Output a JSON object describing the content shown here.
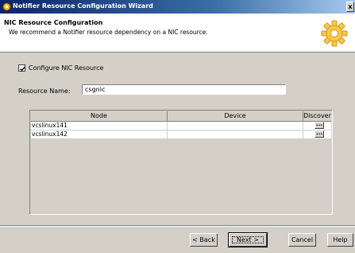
{
  "window": {
    "title": "Notifier Resource Configuration Wizard",
    "close_glyph": "x"
  },
  "header": {
    "title": "NIC Resource Configuration",
    "subtitle": "We recommend a Notifier resource dependency on a NIC resource."
  },
  "configure_nic": {
    "label": "Configure NIC Resource",
    "checked": true
  },
  "resource_name": {
    "label": "Resource Name:",
    "value": "csgnic"
  },
  "table": {
    "columns": [
      "Node",
      "Device",
      "Discover"
    ],
    "rows": [
      {
        "node": "vcslinux141",
        "device": "",
        "discover": "..."
      },
      {
        "node": "vcslinux142",
        "device": "",
        "discover": "..."
      }
    ]
  },
  "buttons": {
    "back": "< Back",
    "next": "Next >",
    "cancel": "Cancel",
    "help": "Help"
  },
  "colors": {
    "titlebar_start": "#0a246a",
    "titlebar_end": "#a6caf0",
    "dialog_bg": "#d4d0c8"
  },
  "icons": {
    "app": "wizard-app-icon",
    "header": "gear-icon"
  }
}
